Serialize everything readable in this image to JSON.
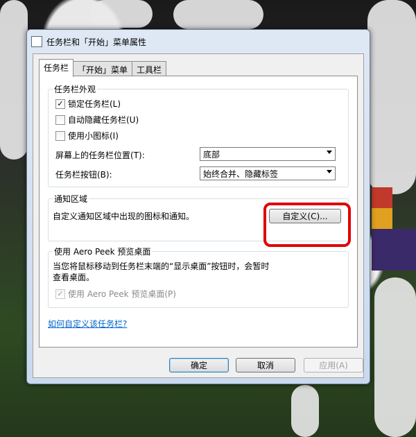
{
  "window": {
    "title": "任务栏和「开始」菜单属性"
  },
  "tabs": [
    {
      "label": "任务栏",
      "active": true
    },
    {
      "label": "「开始」菜单"
    },
    {
      "label": "工具栏"
    }
  ],
  "appearance": {
    "legend": "任务栏外观",
    "lock": {
      "label": "锁定任务栏(L)",
      "checked": true
    },
    "autohide": {
      "label": "自动隐藏任务栏(U)",
      "checked": false
    },
    "small_icons": {
      "label": "使用小图标(I)",
      "checked": false
    },
    "position": {
      "label": "屏幕上的任务栏位置(T):",
      "value": "底部"
    },
    "buttons": {
      "label": "任务栏按钮(B):",
      "value": "始终合并、隐藏标签"
    }
  },
  "notify": {
    "legend": "通知区域",
    "text": "自定义通知区域中出现的图标和通知。",
    "customize_label": "自定义(C)..."
  },
  "aero": {
    "legend": "使用 Aero Peek 预览桌面",
    "desc_line1": "当您将鼠标移动到任务栏末端的“显示桌面”按钮时，会暂时",
    "desc_line2": "查看桌面。",
    "checkbox": {
      "label": "使用 Aero Peek 预览桌面(P)",
      "checked": true
    }
  },
  "help_link": "如何自定义该任务栏?",
  "footer": {
    "ok": "确定",
    "cancel": "取消",
    "apply": "应用(A)"
  },
  "colors": {
    "highlight": "#e00000",
    "link": "#0066cc"
  },
  "icons": {
    "app": "window-icon"
  }
}
